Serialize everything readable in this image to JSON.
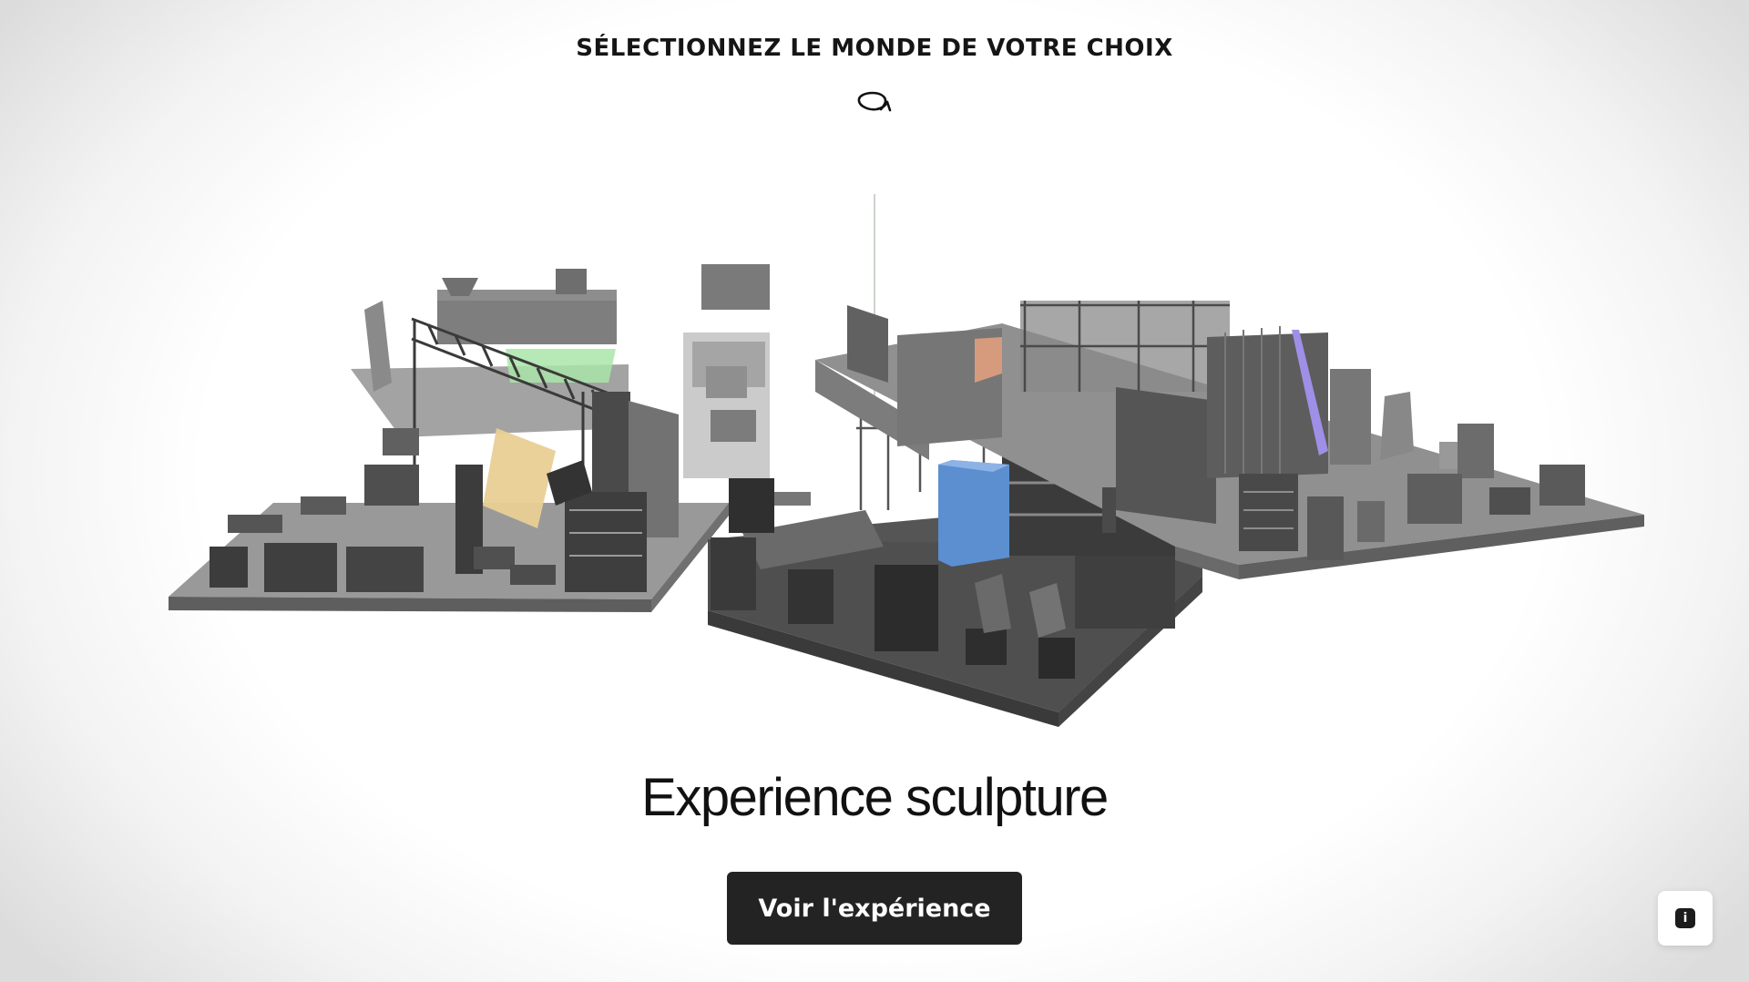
{
  "header": {
    "title": "SÉLECTIONNEZ LE MONDE DE VOTRE CHOIX",
    "rotate_icon": "rotate-arrow-icon"
  },
  "world": {
    "name": "Experience sculpture",
    "cta_label": "Voir l'expérience"
  },
  "info": {
    "icon": "info-icon",
    "glyph": "i"
  },
  "colors": {
    "highlight_blue": "#5b8fd0",
    "highlight_yellow": "#e8cf93",
    "highlight_green": "#a9e5a8",
    "highlight_orange": "#e8a27e",
    "highlight_purple": "#9f8fe6",
    "button_bg": "#232323"
  }
}
